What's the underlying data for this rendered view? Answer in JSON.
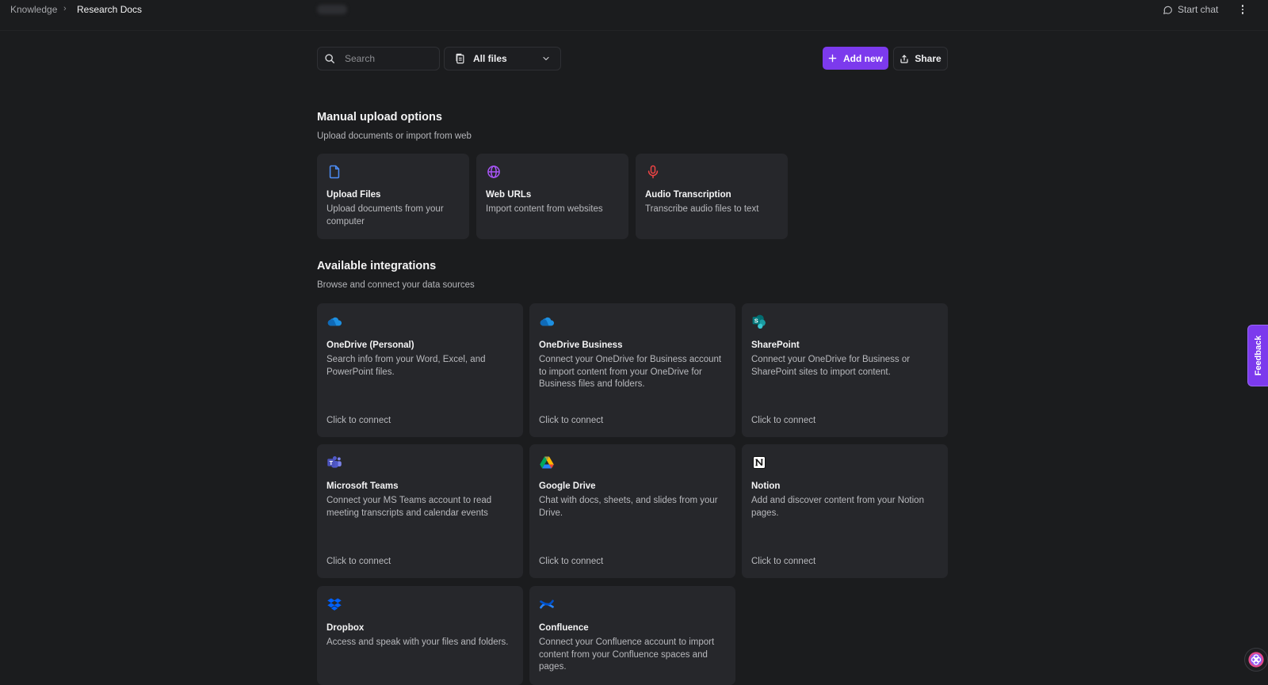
{
  "breadcrumb": {
    "root": "Knowledge",
    "separator": "›",
    "current": "Research Docs"
  },
  "header": {
    "start_chat_label": "Start chat"
  },
  "toolbar": {
    "search_placeholder": "Search",
    "filter_label": "All files",
    "add_new_label": "Add new",
    "share_label": "Share"
  },
  "manual": {
    "title": "Manual upload options",
    "subtitle": "Upload documents or import from web",
    "cards": [
      {
        "icon": "file-icon",
        "title": "Upload Files",
        "description": "Upload documents from your computer"
      },
      {
        "icon": "globe-icon",
        "title": "Web URLs",
        "description": "Import content from websites"
      },
      {
        "icon": "microphone-icon",
        "title": "Audio Transcription",
        "description": "Transcribe audio files to text"
      }
    ]
  },
  "integrations": {
    "title": "Available integrations",
    "subtitle": "Browse and connect your data sources",
    "cards": [
      {
        "icon": "onedrive-icon",
        "title": "OneDrive (Personal)",
        "description": "Search info from your Word, Excel, and PowerPoint files.",
        "footer": "Click to connect"
      },
      {
        "icon": "onedrive-business-icon",
        "title": "OneDrive Business",
        "description": "Connect your OneDrive for Business account to import content from your OneDrive for Business files and folders.",
        "footer": "Click to connect"
      },
      {
        "icon": "sharepoint-icon",
        "title": "SharePoint",
        "description": "Connect your OneDrive for Business or SharePoint sites to import content.",
        "footer": "Click to connect"
      },
      {
        "icon": "microsoft-teams-icon",
        "title": "Microsoft Teams",
        "description": "Connect your MS Teams account to read meeting transcripts and calendar events",
        "footer": "Click to connect"
      },
      {
        "icon": "google-drive-icon",
        "title": "Google Drive",
        "description": "Chat with docs, sheets, and slides from your Drive.",
        "footer": "Click to connect"
      },
      {
        "icon": "notion-icon",
        "title": "Notion",
        "description": "Add and discover content from your Notion pages.",
        "footer": "Click to connect"
      },
      {
        "icon": "dropbox-icon",
        "title": "Dropbox",
        "description": "Access and speak with your files and folders."
      },
      {
        "icon": "confluence-icon",
        "title": "Confluence",
        "description": "Connect your Confluence account to import content from your Confluence spaces and pages."
      }
    ]
  },
  "feedback_label": "Feedback",
  "colors": {
    "background": "#1b1c1e",
    "card": "#26272b",
    "accent": "#7c3aed"
  }
}
